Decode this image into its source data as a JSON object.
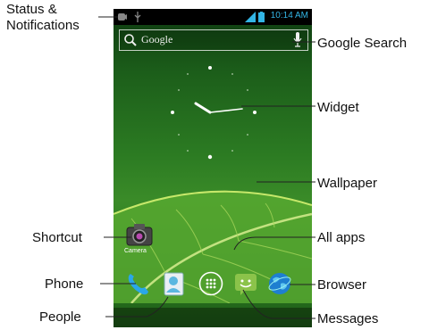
{
  "status_bar": {
    "time": "10:14 AM"
  },
  "search_bar": {
    "placeholder": "Google"
  },
  "shortcut": {
    "label": "Camera"
  },
  "callouts": {
    "status_notifications": "Status &\nNotifications",
    "google_search": "Google Search",
    "widget": "Widget",
    "wallpaper": "Wallpaper",
    "shortcut": "Shortcut",
    "all_apps": "All apps",
    "phone": "Phone",
    "browser": "Browser",
    "people": "People",
    "messages": "Messages"
  },
  "colors": {
    "status_text": "#33b5e5",
    "wallpaper": "#2b7a22"
  }
}
